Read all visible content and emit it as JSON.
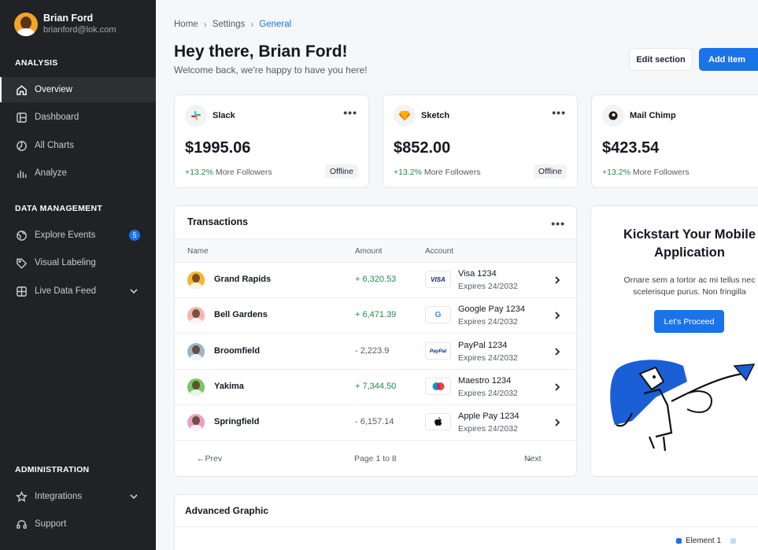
{
  "user": {
    "name": "Brian Ford",
    "email": "brianford@lok.com"
  },
  "sidebar": {
    "sections": [
      {
        "title": "ANALYSIS",
        "items": [
          {
            "label": "Overview",
            "icon": "home-icon",
            "active": true
          },
          {
            "label": "Dashboard",
            "icon": "dashboard-icon"
          },
          {
            "label": "All Charts",
            "icon": "pie-chart-icon"
          },
          {
            "label": "Analyze",
            "icon": "bar-chart-icon"
          }
        ]
      },
      {
        "title": "DATA MANAGEMENT",
        "items": [
          {
            "label": "Explore Events",
            "icon": "globe-icon",
            "badge": "5"
          },
          {
            "label": "Visual Labeling",
            "icon": "tag-icon"
          },
          {
            "label": "Live Data Feed",
            "icon": "grid-icon",
            "chevron": true
          }
        ]
      },
      {
        "title": "ADMINISTRATION",
        "items": [
          {
            "label": "Integrations",
            "icon": "star-icon",
            "chevron": true
          },
          {
            "label": "Support",
            "icon": "headset-icon"
          }
        ]
      }
    ]
  },
  "breadcrumb": [
    "Home",
    "Settings",
    "General"
  ],
  "header": {
    "title": "Hey there, Brian Ford!",
    "subtitle": "Welcome back, we're happy to have you here!",
    "edit_label": "Edit section",
    "add_label": "Add item"
  },
  "stats": [
    {
      "name": "Slack",
      "value": "$1995.06",
      "change": "+13.2%",
      "change_text": "More Followers",
      "badge": "Offline",
      "logo": "slack-logo"
    },
    {
      "name": "Sketch",
      "value": "$852.00",
      "change": "+13.2%",
      "change_text": "More Followers",
      "badge": "Offline",
      "logo": "sketch-logo"
    },
    {
      "name": "Mail Chimp",
      "value": "$423.54",
      "change": "+13.2%",
      "change_text": "More Followers",
      "badge": "",
      "logo": "mailchimp-logo"
    }
  ],
  "transactions": {
    "title": "Transactions",
    "columns": [
      "Name",
      "Amount",
      "Account"
    ],
    "rows": [
      {
        "name": "Grand Rapids",
        "amount": "+ 6,320.53",
        "direction": "pos",
        "account": "Visa 1234",
        "expires": "Expires 24/2032",
        "logo": "VISA",
        "avatar_color": "#f5b335"
      },
      {
        "name": "Bell Gardens",
        "amount": "+ 6,471.39",
        "direction": "pos",
        "account": "Google Pay 1234",
        "expires": "Expires 24/2032",
        "logo": "G",
        "avatar_color": "#f4b6b0"
      },
      {
        "name": "Broomfield",
        "amount": "- 2,223.9",
        "direction": "neg",
        "account": "PayPal 1234",
        "expires": "Expires 24/2032",
        "logo": "PayPal",
        "avatar_color": "#9fb4c4"
      },
      {
        "name": "Yakima",
        "amount": "+ 7,344.50",
        "direction": "pos",
        "account": "Maestro 1234",
        "expires": "Expires 24/2032",
        "logo": "maestro",
        "avatar_color": "#7cc36b"
      },
      {
        "name": "Springfield",
        "amount": "- 6,157.14",
        "direction": "neg",
        "account": "Apple Pay 1234",
        "expires": "Expires 24/2032",
        "logo": "apple",
        "avatar_color": "#e7a3c4"
      }
    ],
    "prev_label": "Prev",
    "page_label": "Page 1 to 8",
    "next_label": "Next"
  },
  "promo": {
    "title_line1": "Kickstart Your Mobile",
    "title_line2": "Application",
    "text_line1": "Ornare sem a tortor ac mi tellus nec",
    "text_line2": "scelerisque purus. Non fringilla",
    "button": "Let's Proceed"
  },
  "advanced": {
    "title": "Advanced Graphic",
    "legend": [
      "Element 1"
    ]
  },
  "colors": {
    "accent": "#1a73e8",
    "positive": "#1f8a4c",
    "sidebar": "#202225"
  }
}
